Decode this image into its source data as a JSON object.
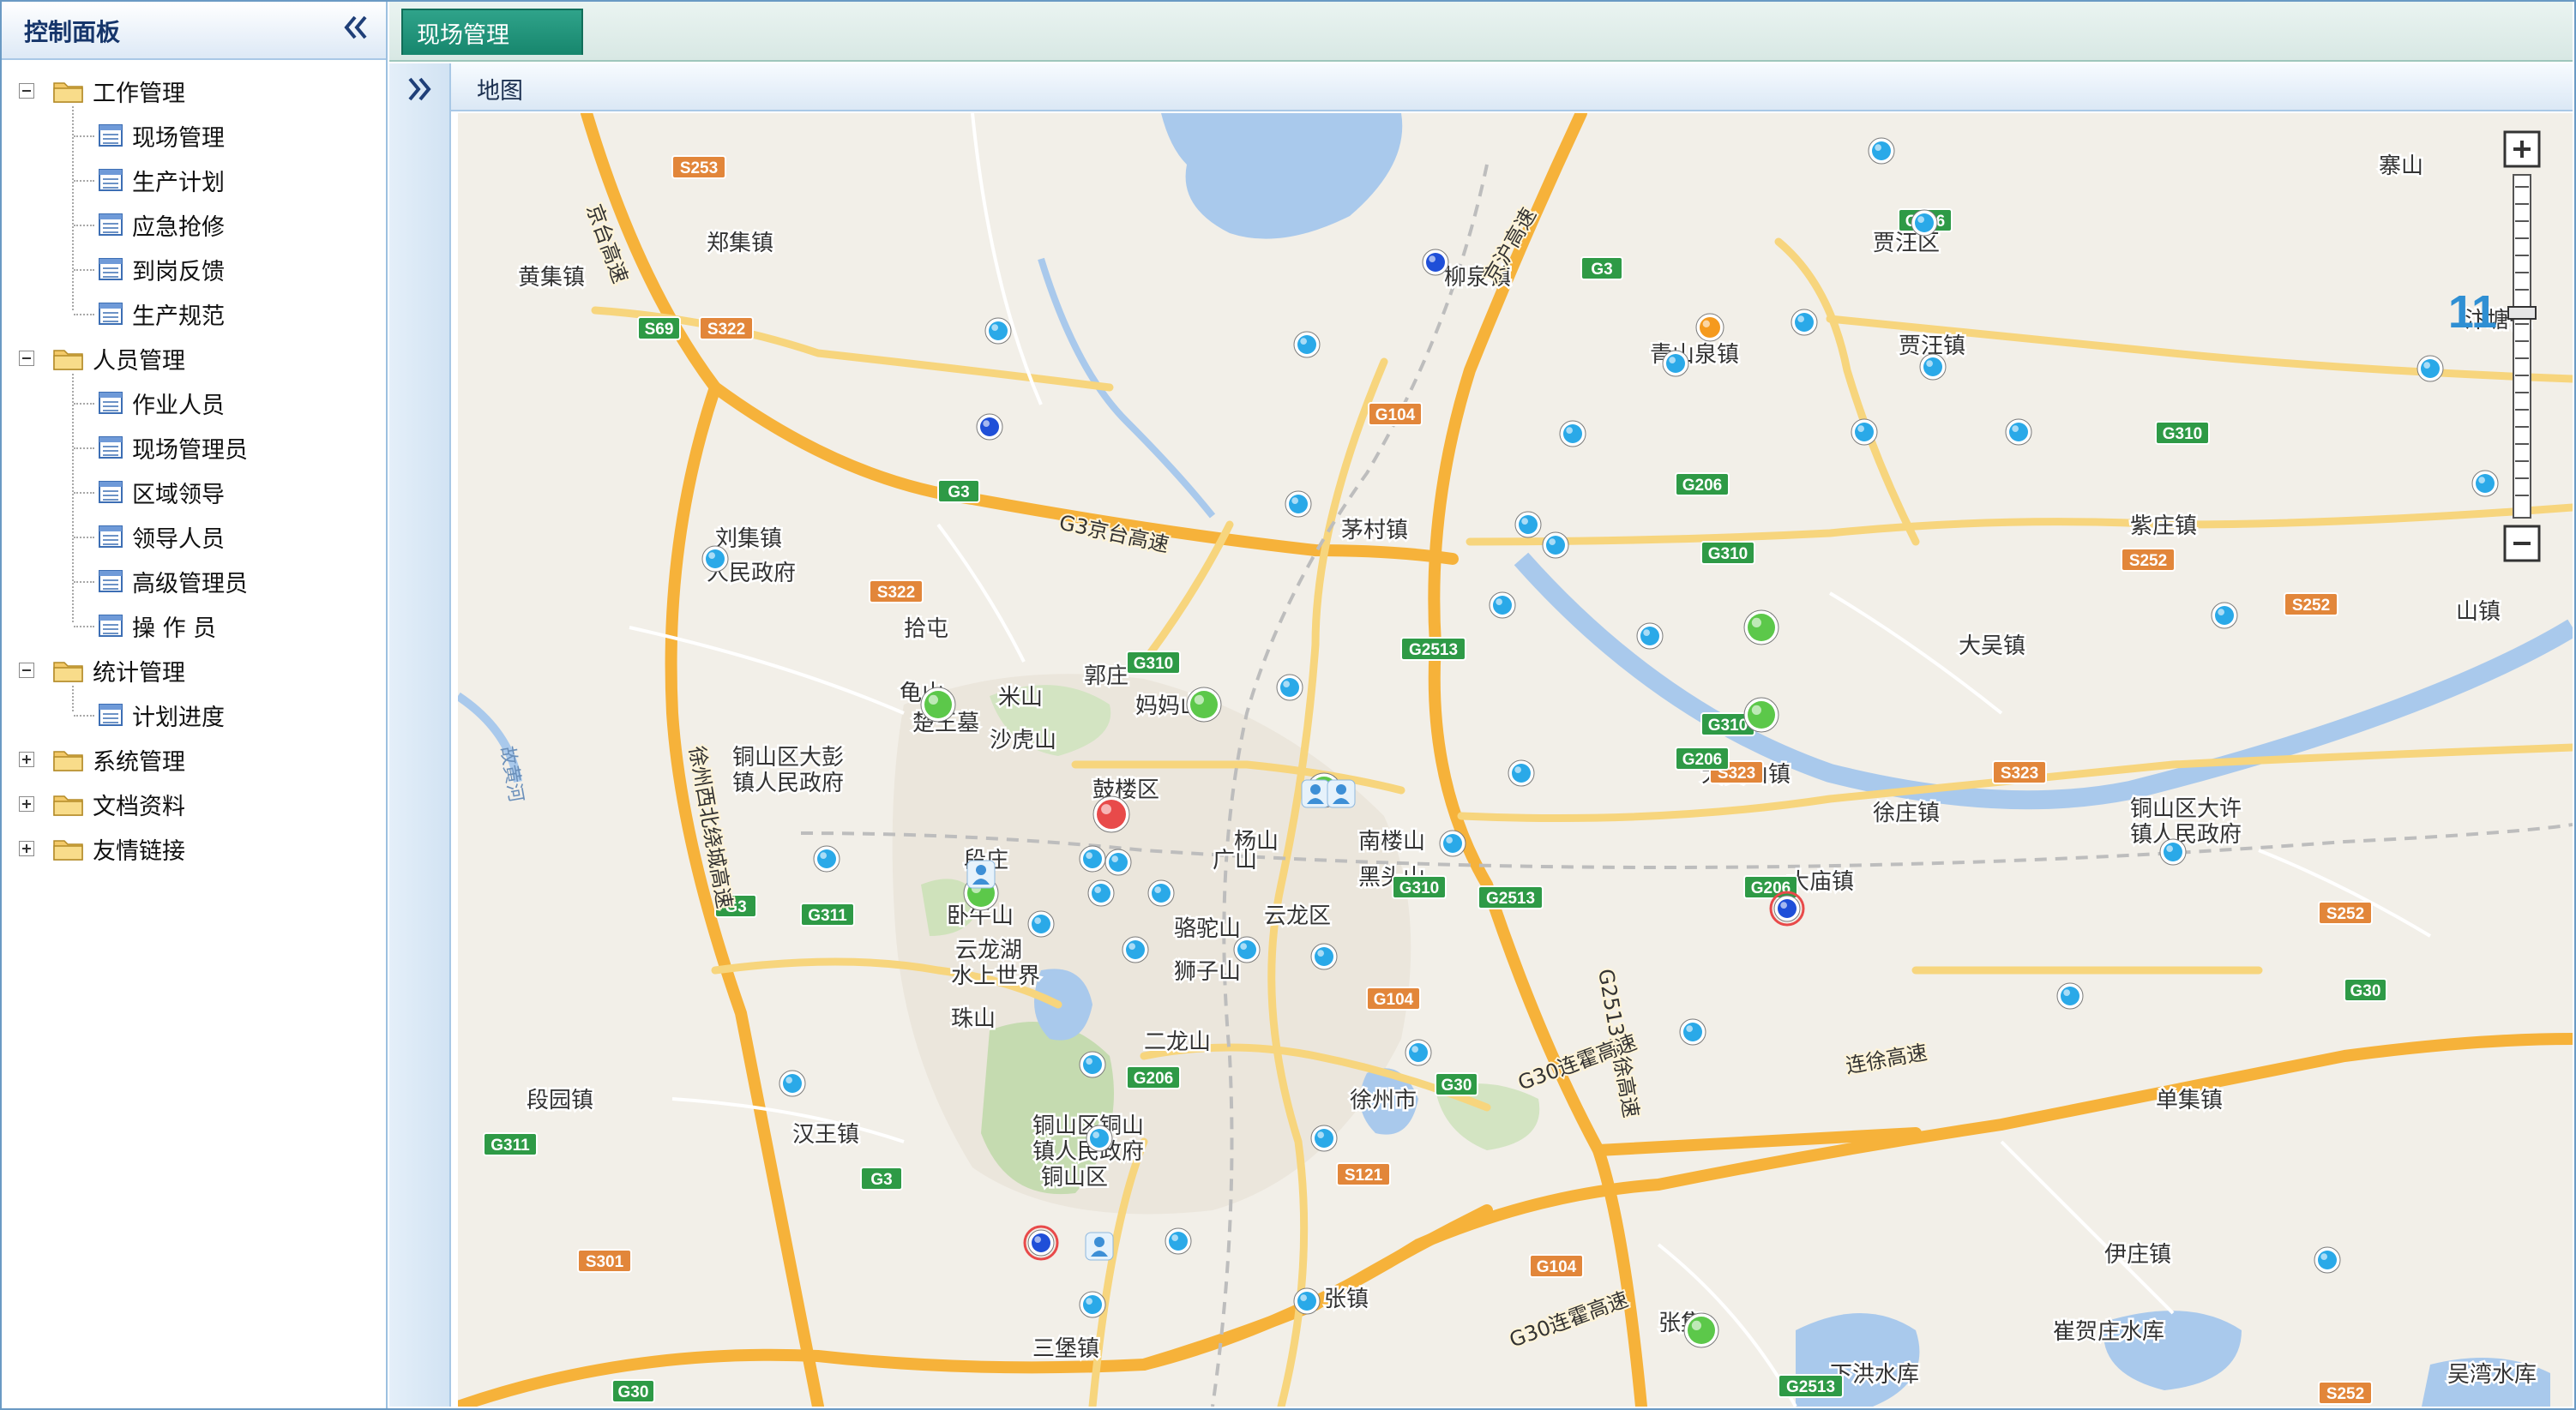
{
  "sidebar": {
    "title": "控制面板",
    "groups": [
      {
        "label": "工作管理",
        "expanded": true,
        "items": [
          "现场管理",
          "生产计划",
          "应急抢修",
          "到岗反馈",
          "生产规范"
        ]
      },
      {
        "label": "人员管理",
        "expanded": true,
        "items": [
          "作业人员",
          "现场管理员",
          "区域领导",
          "领导人员",
          "高级管理员",
          "操 作 员"
        ]
      },
      {
        "label": "统计管理",
        "expanded": true,
        "items": [
          "计划进度"
        ]
      },
      {
        "label": "系统管理",
        "expanded": false,
        "items": []
      },
      {
        "label": "文档资料",
        "expanded": false,
        "items": []
      },
      {
        "label": "友情链接",
        "expanded": false,
        "items": []
      }
    ]
  },
  "tabs": {
    "active": "现场管理"
  },
  "map": {
    "panel_title": "地图",
    "zoom_level": "11",
    "place_labels": [
      "郑集镇",
      "黄集镇",
      "柳泉镇",
      "青山泉镇",
      "贾汪区",
      "贾汪镇",
      "寨山",
      "汴塘镇",
      "刘集镇",
      "人民政府",
      "茅村镇",
      "紫庄镇",
      "大吴镇",
      "山镇",
      "拾屯",
      "龟山",
      "郭庄",
      "米山",
      "妈妈山",
      "楚王墓",
      "沙虎山",
      "鼓楼区",
      "铜山区大彭",
      "镇人民政府",
      "大黄山镇",
      "徐庄镇",
      "铜山区大许",
      "镇人民政府",
      "杨山",
      "南楼山",
      "黑头山",
      "广山",
      "段庄",
      "卧牛山",
      "云龙区",
      "大庙镇",
      "云龙湖",
      "水上世界",
      "珠山",
      "二龙山",
      "段园镇",
      "汉王镇",
      "徐州市",
      "单集镇",
      "铜山区铜山",
      "镇人民政府",
      "铜山区",
      "伊庄镇",
      "三堡镇",
      "张镇",
      "张集",
      "崔贺庄水库",
      "下洪水库",
      "吴湾水库",
      "骆驼山",
      "狮子山",
      "故黄河"
    ],
    "route_shields": [
      "S253",
      "S69",
      "S322",
      "G3",
      "G206",
      "G104",
      "G310",
      "S322",
      "G3",
      "G310",
      "G206",
      "G310",
      "G2513",
      "S252",
      "G310",
      "G206",
      "S323",
      "G2513",
      "G206",
      "S323",
      "S252",
      "G310",
      "G311",
      "G3",
      "G104",
      "G30",
      "G206",
      "G311",
      "G30",
      "S121",
      "G3",
      "S301",
      "G104",
      "G2513",
      "G30",
      "S252",
      "S252"
    ],
    "road_labels": [
      "G3京台高速",
      "徐州西北绕城高速",
      "京沪高速",
      "G2513淮徐高速",
      "G30连霍高速",
      "连徐高速",
      "京台高速",
      "G30连霍高速"
    ],
    "colors": {
      "water": "#a9c9ec",
      "green": "#c5dbb0",
      "expressway": "#f6b23a",
      "highway": "#f7d57d",
      "marker_cyan": "#2aa9e8",
      "marker_green": "#5cc84a",
      "marker_blue": "#1f4fd8",
      "marker_red": "#e84a4a",
      "marker_orange": "#f59a1e",
      "shield_green": "#2e9a46",
      "shield_orange": "#e2863a"
    }
  }
}
